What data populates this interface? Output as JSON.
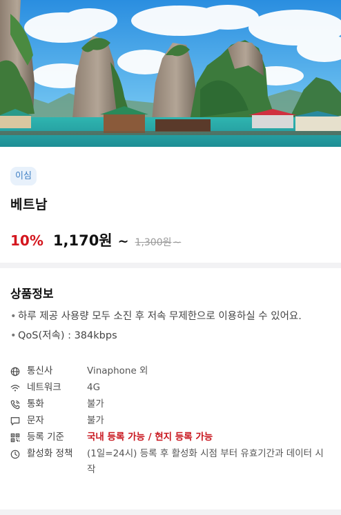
{
  "hero": {
    "image_alt": "Ha Long Bay landscape"
  },
  "product": {
    "badge": "이심",
    "title": "베트남",
    "discount": "10%",
    "price": "1,170원",
    "tilde": "~",
    "original_price": "1,300원",
    "original_tilde": "~"
  },
  "info": {
    "title": "상품정보",
    "bullets": [
      "하루 제공 사용량 모두 소진 후 저속 무제한으로 이용하실 수 있어요.",
      "QoS(저속) : 384kbps"
    ],
    "specs": [
      {
        "icon": "globe-icon",
        "label": "통신사",
        "value": "Vinaphone 외"
      },
      {
        "icon": "wifi-icon",
        "label": "네트워크",
        "value": "4G"
      },
      {
        "icon": "phone-icon",
        "label": "통화",
        "value": "불가"
      },
      {
        "icon": "message-icon",
        "label": "문자",
        "value": "불가"
      },
      {
        "icon": "qr-icon",
        "label": "등록 기준",
        "value": "국내 등록 가능 / 현지 등록 가능",
        "highlight": true
      },
      {
        "icon": "clock-icon",
        "label": "활성화 정책",
        "value": "(1일=24시) 등록 후 활성화 시점 부터 유효기간과 데이터 시작"
      }
    ]
  },
  "colors": {
    "accent_red": "#d4161e",
    "badge_bg": "#e8f1fb",
    "badge_text": "#3f7fc4"
  }
}
